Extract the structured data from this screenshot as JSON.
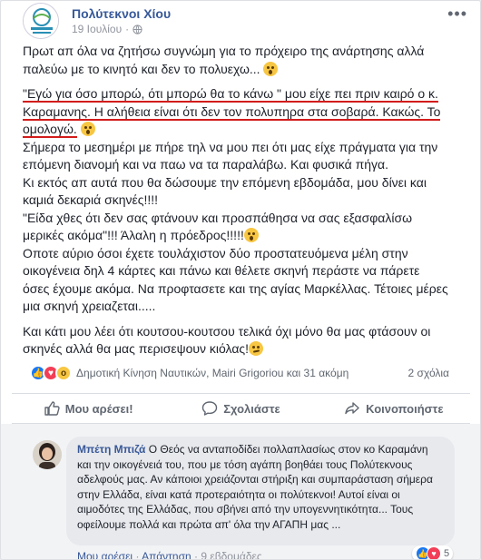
{
  "page": {
    "name": "Πολύτεκνοι Χίου",
    "date": "19 Ιουλίου"
  },
  "post": {
    "paragraphs": [
      {
        "text": "Πρωτ απ όλα να ζητήσω συγνώμη για το πρόχειρο της ανάρτησης αλλά παλεύω με το κινητό και δεν το πολυεχω...",
        "emoji": "wow"
      },
      {
        "text": "\"Εγώ για όσο μπορώ, ότι μπορώ θα το κάνω \" μου είχε πει πριν καιρό ο κ. Καραμανης. Η αλήθεια είναι ότι δεν τον πολυπηρα στα σοβαρά. Κακώς. Το ομολογώ.",
        "emoji": "flushed",
        "underline": true
      },
      {
        "text": "Σήμερα το μεσημέρι με πήρε τηλ να μου πει ότι μας είχε πράγματα για την επόμενη διανομή και να παω να τα παραλάβω. Και φυσικά πήγα."
      },
      {
        "text": "Κι εκτός απ αυτά που θα δώσουμε την επόμενη εβδομάδα, μου δίνει και καμιά δεκαριά σκηνές!!!!"
      },
      {
        "text": "\"Είδα χθες ότι δεν σας φτάνουν και προσπάθησα να σας εξασφαλίσω μερικές ακόμα\"!!! Άλαλη η πρόεδρος!!!!!",
        "emoji": "wow"
      },
      {
        "text": "Οποτε αύριο όσοι έχετε τουλάχιστον δύο προστατευόμενα μέλη στην οικογένεια δηλ 4 κάρτες και πάνω και θέλετε σκηνή περάστε να πάρετε όσες έχουμε ακόμα. Να προφτασετε και της αγίας Μαρκέλλας. Τέτοιες μέρες μια σκηνή χρειαζεται....."
      },
      {
        "text": "Και κάτι μου λέει ότι κουτσου-κουτσου τελικά όχι μόνο θα μας φτάσουν οι σκηνές αλλά θα μας περισεψουν κιόλας!",
        "emoji": "smirk",
        "gap": true
      }
    ]
  },
  "reactions": {
    "summary": "Δημοτική Κίνηση Ναυτικών, Mairi Grigoriou και 31 ακόμη",
    "comments": "2 σχόλια"
  },
  "actions": {
    "like": "Μου αρέσει!",
    "comment": "Σχολιάστε",
    "share": "Κοινοποιήστε"
  },
  "comment": {
    "author": "Μπέτη Μπιζά",
    "text": "Ο Θεός να ανταποδίδει πολλαπλασίως στον κο Καραμάνη και την οικογένειά του, που με τόση αγάπη βοηθάει τους Πολύτεκνους αδελφούς μας. Αν κάποιοι χρειάζονται στήριξη και συμπαράσταση σήμερα στην Ελλάδα, είναι κατά προτεραιότητα οι πολύτεκνοι! Αυτοί είναι οι αιμοδότες της Ελλάδας, που σβήνει από την υπογεννητικότητα... Τους οφείλουμε πολλά και πρώτα απ' όλα την ΑΓΑΠΗ μας ...",
    "footer_like": "Μου αρέσει",
    "footer_reply": "Απάντηση",
    "footer_time": "9 εβδομάδες",
    "reaction_count": "5"
  },
  "colors": {
    "link": "#365899",
    "underline": "#d21c1c",
    "like": "#1877f2"
  }
}
